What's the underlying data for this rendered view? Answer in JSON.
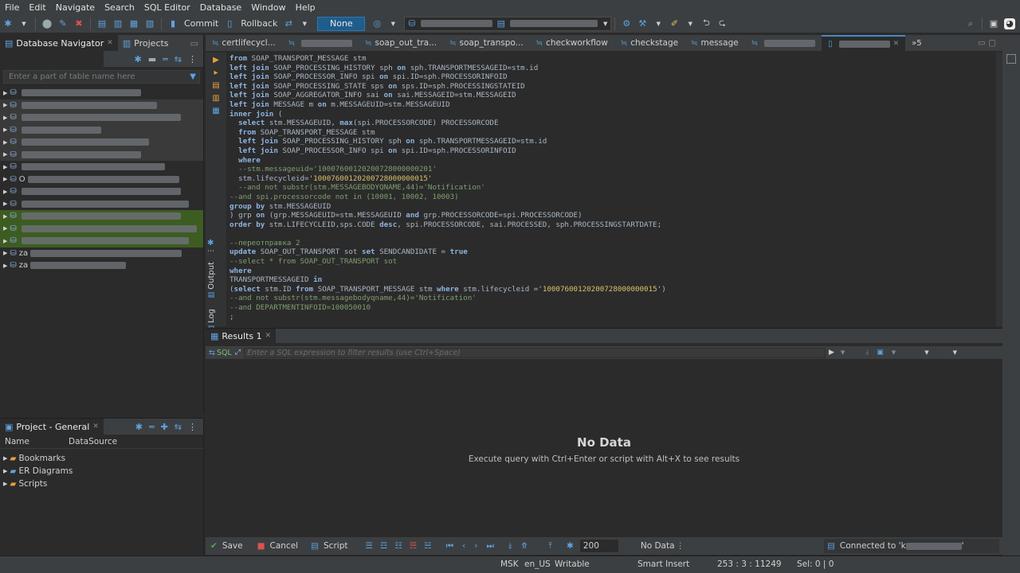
{
  "menu": [
    "File",
    "Edit",
    "Navigate",
    "Search",
    "SQL Editor",
    "Database",
    "Window",
    "Help"
  ],
  "toolbar": {
    "commit": "Commit",
    "rollback": "Rollback",
    "transaction_mode": "None"
  },
  "left": {
    "tabs": [
      "Database Navigator",
      "Projects"
    ],
    "filter_placeholder": "Enter a part of table name here",
    "nav_rows": [
      {
        "style": "normal",
        "prefix": ""
      },
      {
        "style": "grey",
        "prefix": ""
      },
      {
        "style": "grey",
        "prefix": ""
      },
      {
        "style": "grey",
        "prefix": ""
      },
      {
        "style": "grey",
        "prefix": ""
      },
      {
        "style": "grey",
        "prefix": ""
      },
      {
        "style": "normal",
        "prefix": ""
      },
      {
        "style": "normal",
        "prefix": "O"
      },
      {
        "style": "normal",
        "prefix": ""
      },
      {
        "style": "normal",
        "prefix": ""
      },
      {
        "style": "green",
        "prefix": ""
      },
      {
        "style": "green",
        "prefix": ""
      },
      {
        "style": "green",
        "prefix": ""
      },
      {
        "style": "normal",
        "prefix": "za"
      },
      {
        "style": "normal",
        "prefix": "za"
      }
    ]
  },
  "project": {
    "title": "Project - General",
    "col_name": "Name",
    "col_datasource": "DataSource",
    "items": [
      "Bookmarks",
      "ER Diagrams",
      "Scripts"
    ]
  },
  "editor": {
    "tabs": [
      "certlifecycl...",
      "",
      "soap_out_tra...",
      "soap_transpo...",
      "checkworkflow",
      "checkstage",
      "message",
      "",
      ""
    ],
    "overflow": "»5"
  },
  "side_tabs": {
    "output": "Output",
    "log": "Log"
  },
  "results": {
    "tab": "Results 1",
    "sql_label": "SQL",
    "filter_placeholder": "Enter a SQL expression to filter results (use Ctrl+Space)",
    "no_data_title": "No Data",
    "no_data_hint": "Execute query with Ctrl+Enter or script with Alt+X to see results",
    "save": "Save",
    "cancel": "Cancel",
    "script": "Script",
    "fetch_size": "200",
    "status": "No Data",
    "connected": "Connected to 'k"
  },
  "status": {
    "tz": "MSK",
    "locale": "en_US",
    "mode": "Writable",
    "insert": "Smart Insert",
    "pos": "253 : 3 : 11249",
    "sel": "Sel: 0 | 0"
  }
}
